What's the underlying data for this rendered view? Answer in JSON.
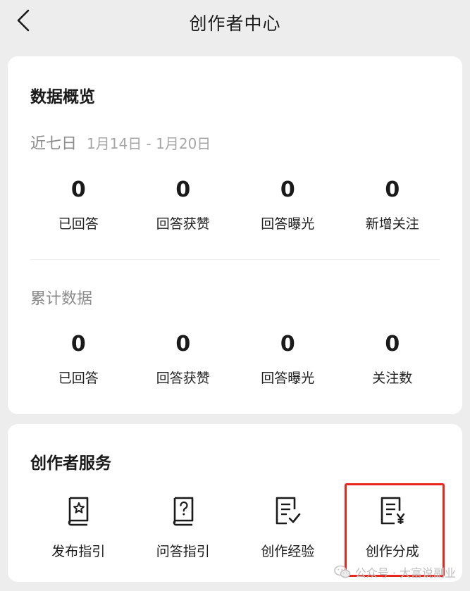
{
  "header": {
    "title": "创作者中心"
  },
  "overview": {
    "title": "数据概览",
    "recent": {
      "label": "近七日",
      "range": "1月14日 - 1月20日",
      "stats": [
        {
          "value": "0",
          "label": "已回答"
        },
        {
          "value": "0",
          "label": "回答获赞"
        },
        {
          "value": "0",
          "label": "回答曝光"
        },
        {
          "value": "0",
          "label": "新增关注"
        }
      ]
    },
    "cumulative": {
      "label": "累计数据",
      "stats": [
        {
          "value": "0",
          "label": "已回答"
        },
        {
          "value": "0",
          "label": "回答获赞"
        },
        {
          "value": "0",
          "label": "回答曝光"
        },
        {
          "value": "0",
          "label": "关注数"
        }
      ]
    }
  },
  "services": {
    "title": "创作者服务",
    "items": [
      {
        "label": "发布指引",
        "icon": "book-star-icon"
      },
      {
        "label": "问答指引",
        "icon": "book-question-icon"
      },
      {
        "label": "创作经验",
        "icon": "document-check-icon"
      },
      {
        "label": "创作分成",
        "icon": "document-yen-icon"
      }
    ]
  },
  "watermark": {
    "text": "公众号 · 大富说副业"
  },
  "colors": {
    "highlight": "#e8251f",
    "background": "#ededed"
  }
}
